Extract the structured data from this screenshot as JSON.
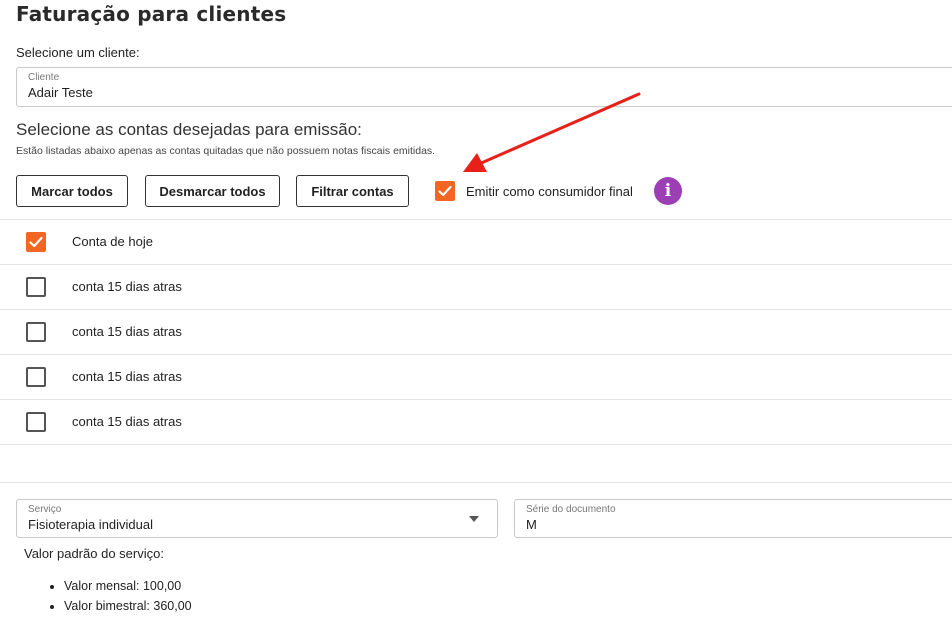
{
  "page": {
    "title": "Faturação para clientes"
  },
  "client": {
    "prompt": "Selecione um cliente:",
    "field_label": "Cliente",
    "value": "Adair Teste"
  },
  "accounts": {
    "heading": "Selecione as contas desejadas para emissão:",
    "note": "Estão listadas abaixo apenas as contas quitadas que não possuem notas fiscais emitidas.",
    "buttons": {
      "select_all": "Marcar todos",
      "deselect_all": "Desmarcar todos",
      "filter": "Filtrar contas"
    },
    "final_consumer": {
      "label": "Emitir como consumidor final",
      "checked": true
    },
    "items": [
      {
        "label": "Conta de hoje",
        "checked": true
      },
      {
        "label": "conta 15 dias atras",
        "checked": false
      },
      {
        "label": "conta 15 dias atras",
        "checked": false
      },
      {
        "label": "conta 15 dias atras",
        "checked": false
      },
      {
        "label": "conta 15 dias atras",
        "checked": false
      }
    ]
  },
  "service": {
    "field_label": "Serviço",
    "value": "Fisioterapia individual",
    "default_value_label": "Valor padrão do serviço:",
    "prices": [
      "Valor mensal: 100,00",
      "Valor bimestral: 360,00"
    ]
  },
  "document_series": {
    "field_label": "Série do documento",
    "value": "M"
  },
  "colors": {
    "accent": "#f26522",
    "info": "#9c3fb5",
    "annotation_arrow": "#e8201a"
  },
  "icons": {
    "info": "info-icon",
    "check": "checkmark-icon",
    "dropdown": "chevron-down-icon",
    "annotation": "red-arrow-annotation"
  }
}
